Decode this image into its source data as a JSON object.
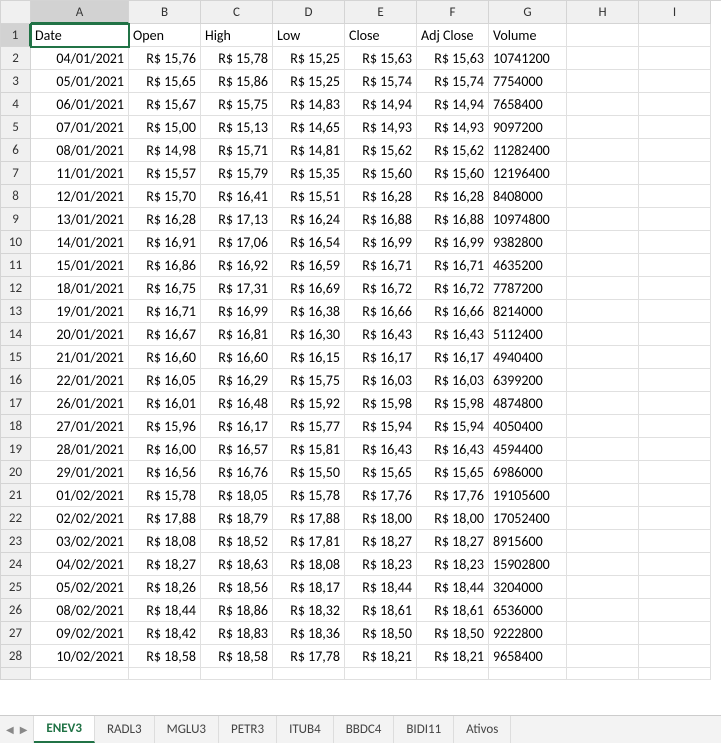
{
  "columns": [
    "A",
    "B",
    "C",
    "D",
    "E",
    "F",
    "G",
    "H",
    "I"
  ],
  "headers": [
    "Date",
    "Open",
    "High",
    "Low",
    "Close",
    "Adj Close",
    "Volume"
  ],
  "rows": [
    {
      "n": 1
    },
    {
      "n": 2,
      "date": "04/01/2021",
      "open": "R$ 15,76",
      "high": "R$ 15,78",
      "low": "R$ 15,25",
      "close": "R$ 15,63",
      "adj": "R$ 15,63",
      "vol": "10741200"
    },
    {
      "n": 3,
      "date": "05/01/2021",
      "open": "R$ 15,65",
      "high": "R$ 15,86",
      "low": "R$ 15,25",
      "close": "R$ 15,74",
      "adj": "R$ 15,74",
      "vol": "7754000"
    },
    {
      "n": 4,
      "date": "06/01/2021",
      "open": "R$ 15,67",
      "high": "R$ 15,75",
      "low": "R$ 14,83",
      "close": "R$ 14,94",
      "adj": "R$ 14,94",
      "vol": "7658400"
    },
    {
      "n": 5,
      "date": "07/01/2021",
      "open": "R$ 15,00",
      "high": "R$ 15,13",
      "low": "R$ 14,65",
      "close": "R$ 14,93",
      "adj": "R$ 14,93",
      "vol": "9097200"
    },
    {
      "n": 6,
      "date": "08/01/2021",
      "open": "R$ 14,98",
      "high": "R$ 15,71",
      "low": "R$ 14,81",
      "close": "R$ 15,62",
      "adj": "R$ 15,62",
      "vol": "11282400"
    },
    {
      "n": 7,
      "date": "11/01/2021",
      "open": "R$ 15,57",
      "high": "R$ 15,79",
      "low": "R$ 15,35",
      "close": "R$ 15,60",
      "adj": "R$ 15,60",
      "vol": "12196400"
    },
    {
      "n": 8,
      "date": "12/01/2021",
      "open": "R$ 15,70",
      "high": "R$ 16,41",
      "low": "R$ 15,51",
      "close": "R$ 16,28",
      "adj": "R$ 16,28",
      "vol": "8408000"
    },
    {
      "n": 9,
      "date": "13/01/2021",
      "open": "R$ 16,28",
      "high": "R$ 17,13",
      "low": "R$ 16,24",
      "close": "R$ 16,88",
      "adj": "R$ 16,88",
      "vol": "10974800"
    },
    {
      "n": 10,
      "date": "14/01/2021",
      "open": "R$ 16,91",
      "high": "R$ 17,06",
      "low": "R$ 16,54",
      "close": "R$ 16,99",
      "adj": "R$ 16,99",
      "vol": "9382800"
    },
    {
      "n": 11,
      "date": "15/01/2021",
      "open": "R$ 16,86",
      "high": "R$ 16,92",
      "low": "R$ 16,59",
      "close": "R$ 16,71",
      "adj": "R$ 16,71",
      "vol": "4635200"
    },
    {
      "n": 12,
      "date": "18/01/2021",
      "open": "R$ 16,75",
      "high": "R$ 17,31",
      "low": "R$ 16,69",
      "close": "R$ 16,72",
      "adj": "R$ 16,72",
      "vol": "7787200"
    },
    {
      "n": 13,
      "date": "19/01/2021",
      "open": "R$ 16,71",
      "high": "R$ 16,99",
      "low": "R$ 16,38",
      "close": "R$ 16,66",
      "adj": "R$ 16,66",
      "vol": "8214000"
    },
    {
      "n": 14,
      "date": "20/01/2021",
      "open": "R$ 16,67",
      "high": "R$ 16,81",
      "low": "R$ 16,30",
      "close": "R$ 16,43",
      "adj": "R$ 16,43",
      "vol": "5112400"
    },
    {
      "n": 15,
      "date": "21/01/2021",
      "open": "R$ 16,60",
      "high": "R$ 16,60",
      "low": "R$ 16,15",
      "close": "R$ 16,17",
      "adj": "R$ 16,17",
      "vol": "4940400"
    },
    {
      "n": 16,
      "date": "22/01/2021",
      "open": "R$ 16,05",
      "high": "R$ 16,29",
      "low": "R$ 15,75",
      "close": "R$ 16,03",
      "adj": "R$ 16,03",
      "vol": "6399200"
    },
    {
      "n": 17,
      "date": "26/01/2021",
      "open": "R$ 16,01",
      "high": "R$ 16,48",
      "low": "R$ 15,92",
      "close": "R$ 15,98",
      "adj": "R$ 15,98",
      "vol": "4874800"
    },
    {
      "n": 18,
      "date": "27/01/2021",
      "open": "R$ 15,96",
      "high": "R$ 16,17",
      "low": "R$ 15,77",
      "close": "R$ 15,94",
      "adj": "R$ 15,94",
      "vol": "4050400"
    },
    {
      "n": 19,
      "date": "28/01/2021",
      "open": "R$ 16,00",
      "high": "R$ 16,57",
      "low": "R$ 15,81",
      "close": "R$ 16,43",
      "adj": "R$ 16,43",
      "vol": "4594400"
    },
    {
      "n": 20,
      "date": "29/01/2021",
      "open": "R$ 16,56",
      "high": "R$ 16,76",
      "low": "R$ 15,50",
      "close": "R$ 15,65",
      "adj": "R$ 15,65",
      "vol": "6986000"
    },
    {
      "n": 21,
      "date": "01/02/2021",
      "open": "R$ 15,78",
      "high": "R$ 18,05",
      "low": "R$ 15,78",
      "close": "R$ 17,76",
      "adj": "R$ 17,76",
      "vol": "19105600"
    },
    {
      "n": 22,
      "date": "02/02/2021",
      "open": "R$ 17,88",
      "high": "R$ 18,79",
      "low": "R$ 17,88",
      "close": "R$ 18,00",
      "adj": "R$ 18,00",
      "vol": "17052400"
    },
    {
      "n": 23,
      "date": "03/02/2021",
      "open": "R$ 18,08",
      "high": "R$ 18,52",
      "low": "R$ 17,81",
      "close": "R$ 18,27",
      "adj": "R$ 18,27",
      "vol": "8915600"
    },
    {
      "n": 24,
      "date": "04/02/2021",
      "open": "R$ 18,27",
      "high": "R$ 18,63",
      "low": "R$ 18,08",
      "close": "R$ 18,23",
      "adj": "R$ 18,23",
      "vol": "15902800"
    },
    {
      "n": 25,
      "date": "05/02/2021",
      "open": "R$ 18,26",
      "high": "R$ 18,56",
      "low": "R$ 18,17",
      "close": "R$ 18,44",
      "adj": "R$ 18,44",
      "vol": "3204000"
    },
    {
      "n": 26,
      "date": "08/02/2021",
      "open": "R$ 18,44",
      "high": "R$ 18,86",
      "low": "R$ 18,32",
      "close": "R$ 18,61",
      "adj": "R$ 18,61",
      "vol": "6536000"
    },
    {
      "n": 27,
      "date": "09/02/2021",
      "open": "R$ 18,42",
      "high": "R$ 18,83",
      "low": "R$ 18,36",
      "close": "R$ 18,50",
      "adj": "R$ 18,50",
      "vol": "9222800"
    },
    {
      "n": 28,
      "date": "10/02/2021",
      "open": "R$ 18,58",
      "high": "R$ 18,58",
      "low": "R$ 17,78",
      "close": "R$ 18,21",
      "adj": "R$ 18,21",
      "vol": "9658400"
    }
  ],
  "tabs": [
    "ENEV3",
    "RADL3",
    "MGLU3",
    "PETR3",
    "ITUB4",
    "BBDC4",
    "BIDI11",
    "Ativos"
  ],
  "active_tab": 0,
  "active_cell": {
    "row": 1,
    "col": "A"
  }
}
